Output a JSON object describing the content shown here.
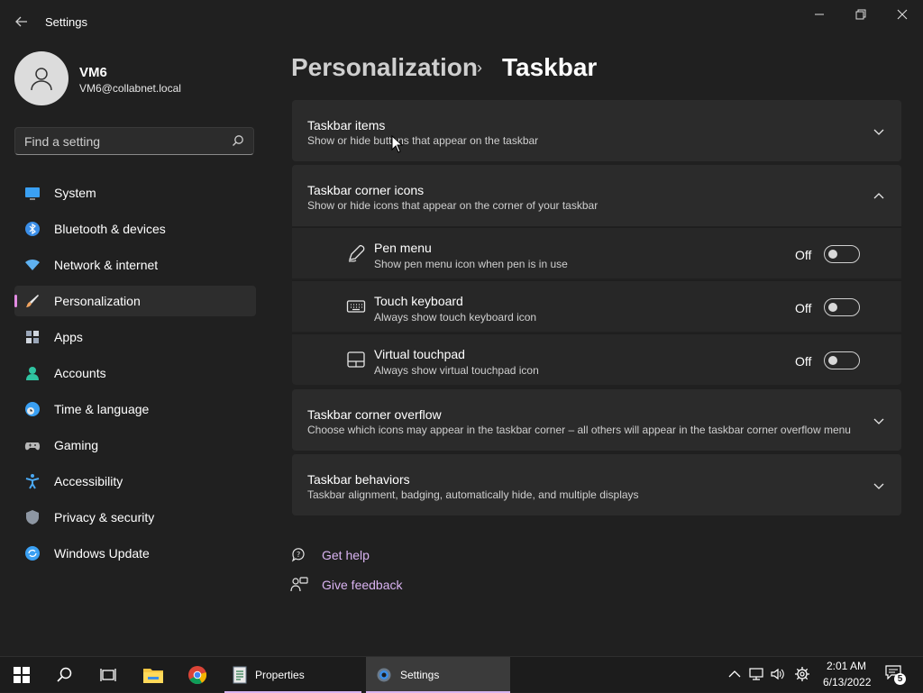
{
  "window": {
    "title": "Settings"
  },
  "user": {
    "name": "VM6",
    "email": "VM6@collabnet.local"
  },
  "search": {
    "placeholder": "Find a setting"
  },
  "sidebar": {
    "items": [
      {
        "label": "System",
        "icon": "monitor-icon",
        "color": "#3aa0f3"
      },
      {
        "label": "Bluetooth & devices",
        "icon": "bluetooth-icon",
        "color": "#3a8ee8"
      },
      {
        "label": "Network & internet",
        "icon": "wifi-icon",
        "color": "#5fb2f2"
      },
      {
        "label": "Personalization",
        "icon": "brush-icon",
        "color": "#f0a460",
        "selected": true
      },
      {
        "label": "Apps",
        "icon": "apps-icon",
        "color": "#9aa6b8"
      },
      {
        "label": "Accounts",
        "icon": "person-icon",
        "color": "#2fc4a1"
      },
      {
        "label": "Time & language",
        "icon": "globe-clock-icon",
        "color": "#3aa0f3"
      },
      {
        "label": "Gaming",
        "icon": "gamepad-icon",
        "color": "#b7b7b7"
      },
      {
        "label": "Accessibility",
        "icon": "accessibility-icon",
        "color": "#4aa8f3"
      },
      {
        "label": "Privacy & security",
        "icon": "shield-icon",
        "color": "#8e97a3"
      },
      {
        "label": "Windows Update",
        "icon": "update-icon",
        "color": "#3aa0f3"
      }
    ]
  },
  "breadcrumb": {
    "parent": "Personalization",
    "separator": "›",
    "current": "Taskbar"
  },
  "sections": {
    "taskbar_items": {
      "title": "Taskbar items",
      "desc": "Show or hide buttons that appear on the taskbar",
      "expanded": false
    },
    "corner_icons": {
      "title": "Taskbar corner icons",
      "desc": "Show or hide icons that appear on the corner of your taskbar",
      "expanded": true,
      "items": [
        {
          "title": "Pen menu",
          "desc": "Show pen menu icon when pen is in use",
          "state": "Off",
          "icon": "pen-icon"
        },
        {
          "title": "Touch keyboard",
          "desc": "Always show touch keyboard icon",
          "state": "Off",
          "icon": "keyboard-icon"
        },
        {
          "title": "Virtual touchpad",
          "desc": "Always show virtual touchpad icon",
          "state": "Off",
          "icon": "touchpad-icon"
        }
      ]
    },
    "corner_overflow": {
      "title": "Taskbar corner overflow",
      "desc": "Choose which icons may appear in the taskbar corner – all others will appear in the taskbar corner overflow menu",
      "expanded": false
    },
    "behaviors": {
      "title": "Taskbar behaviors",
      "desc": "Taskbar alignment, badging, automatically hide, and multiple displays",
      "expanded": false
    }
  },
  "links": {
    "help": "Get help",
    "feedback": "Give feedback"
  },
  "taskbar": {
    "apps": [
      {
        "label": "Properties",
        "icon": "properties-icon"
      },
      {
        "label": "Settings",
        "icon": "settings-gear-icon",
        "active": true
      }
    ],
    "time": "2:01 AM",
    "date": "6/13/2022",
    "notification_count": "5"
  },
  "colors": {
    "accent": "#d9b3f1",
    "background": "#202020",
    "card": "#2b2b2b"
  }
}
